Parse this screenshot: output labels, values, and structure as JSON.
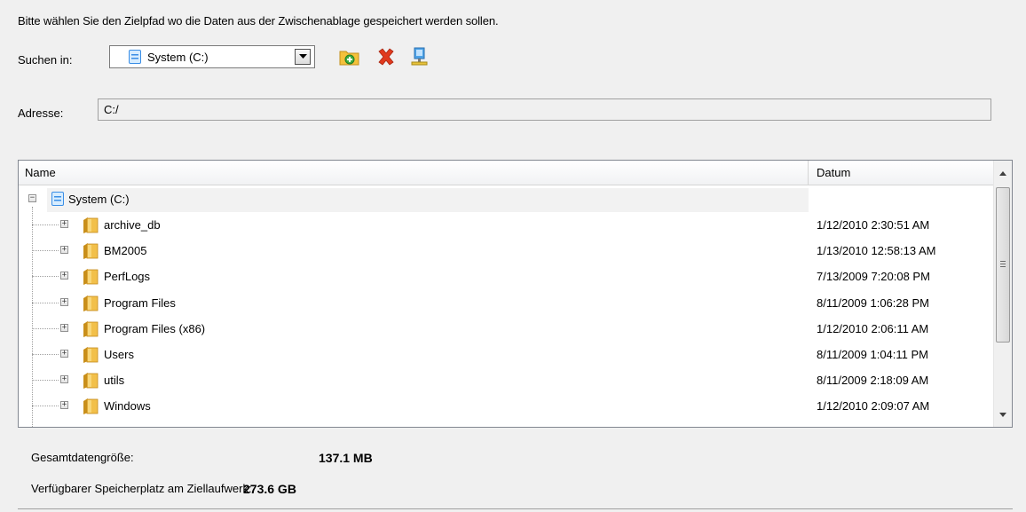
{
  "instruction": "Bitte wählen Sie den Zielpfad wo die Daten aus der Zwischenablage gespeichert werden sollen.",
  "lookin": {
    "label": "Suchen in:",
    "selected": "System (C:)"
  },
  "toolbar": {
    "new_folder_icon": "new-folder-icon",
    "delete_icon": "delete-icon",
    "network_icon": "network-drive-icon"
  },
  "address": {
    "label": "Adresse:",
    "value": "C:/"
  },
  "tree": {
    "columns": [
      "Name",
      "Datum"
    ],
    "root": {
      "label": "System (C:)",
      "expander": "−"
    },
    "rows": [
      {
        "name": "archive_db",
        "date": "1/12/2010 2:30:51 AM"
      },
      {
        "name": "BM2005",
        "date": "1/13/2010 12:58:13 AM"
      },
      {
        "name": "PerfLogs",
        "date": "7/13/2009 7:20:08 PM"
      },
      {
        "name": "Program Files",
        "date": "8/11/2009 1:06:28 PM"
      },
      {
        "name": "Program Files (x86)",
        "date": "1/12/2010 2:06:11 AM"
      },
      {
        "name": "Users",
        "date": "8/11/2009 1:04:11 PM"
      },
      {
        "name": "utils",
        "date": "8/11/2009 2:18:09 AM"
      },
      {
        "name": "Windows",
        "date": "1/12/2010 2:09:07 AM"
      }
    ]
  },
  "summary": {
    "total_label": "Gesamtdatengröße:",
    "total_value": "137.1 MB",
    "free_label": "Verfügbarer Speicherplatz am Ziellaufwerk:",
    "free_value": "273.6 GB"
  },
  "colors": {
    "background": "#f0f0f0",
    "folder": "#e8b339",
    "drive": "#3a8ee6",
    "delete": "#e03a1e"
  }
}
